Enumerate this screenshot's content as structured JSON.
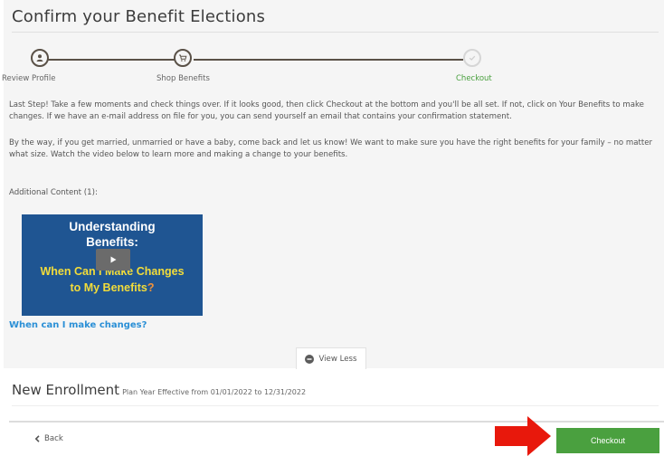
{
  "page": {
    "title": "Confirm your Benefit Elections"
  },
  "steps": [
    {
      "label": "Review Profile",
      "icon": "user-icon",
      "state": "complete"
    },
    {
      "label": "Shop Benefits",
      "icon": "cart-icon",
      "state": "complete"
    },
    {
      "label": "Checkout",
      "icon": "check-icon",
      "state": "current"
    }
  ],
  "colors": {
    "accent_green": "#4aa03f",
    "link_blue": "#2a8fd6",
    "step_dark": "#5a5147",
    "arrow_red": "#e8180c"
  },
  "content": {
    "paragraph1": "Last Step! Take a few moments and check things over. If it looks good, then click Checkout at the bottom and you'll be all set. If not, click on Your Benefits to make changes. If we have an e-mail address on file for you, you can send yourself an email that contains your confirmation statement.",
    "paragraph2": "By the way, if you get married, unmarried or have a baby, come back and let us know! We want to make sure you have the right benefits for your family – no matter what size. Watch the video below to learn more and making a change to your benefits.",
    "additional_label": "Additional Content (1):"
  },
  "video": {
    "thumb_line1": "Understanding",
    "thumb_line2": "Benefits:",
    "thumb_line3": "When Can I Make Changes",
    "thumb_line4": "to My Benefits",
    "thumb_q": "?",
    "link_text": "When can I make changes?"
  },
  "view_less": {
    "label": "View Less",
    "icon": "minus-circle-icon"
  },
  "enrollment": {
    "title": "New Enrollment",
    "subtitle": "Plan Year Effective from 01/01/2022 to 12/31/2022"
  },
  "footer": {
    "back_label": "Back",
    "checkout_label": "Checkout"
  }
}
